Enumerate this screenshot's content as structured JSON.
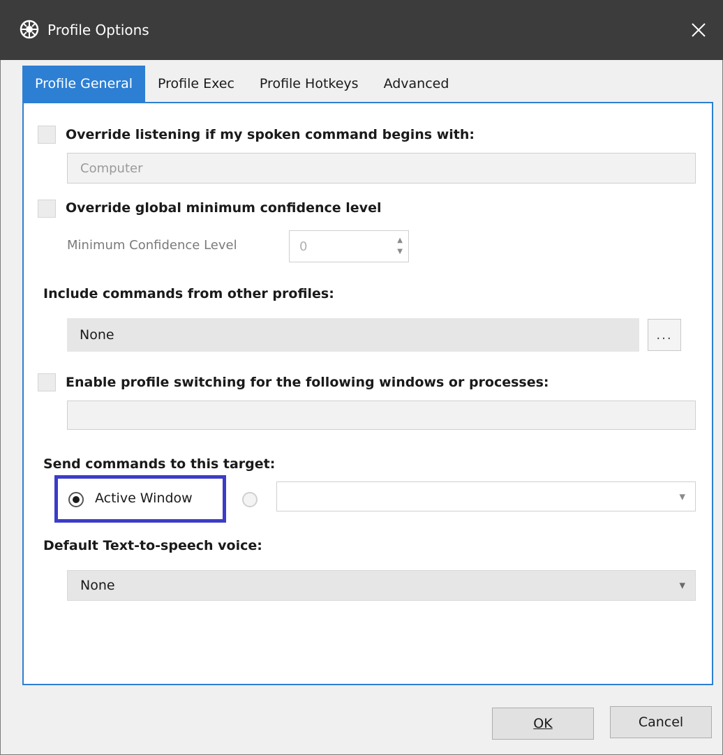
{
  "window": {
    "title": "Profile Options",
    "icon": "voice-app-icon",
    "close_glyph": "✕"
  },
  "tabs": [
    {
      "label": "Profile General",
      "active": true
    },
    {
      "label": "Profile Exec",
      "active": false
    },
    {
      "label": "Profile Hotkeys",
      "active": false
    },
    {
      "label": "Advanced",
      "active": false
    }
  ],
  "general": {
    "override_listening": {
      "label": "Override listening if my spoken command begins with:",
      "checked": false,
      "placeholder": "Computer"
    },
    "override_confidence": {
      "label": "Override global minimum confidence level",
      "checked": false,
      "sub_label": "Minimum Confidence Level",
      "value": "0"
    },
    "include_commands": {
      "label": "Include commands from other profiles:",
      "value": "None",
      "browse_label": "..."
    },
    "profile_switching": {
      "label": "Enable profile switching for the following windows or processes:",
      "checked": false,
      "value": ""
    },
    "send_target": {
      "label": "Send commands to this target:",
      "active_window_label": "Active Window",
      "active_window_selected": true,
      "other_target_value": ""
    },
    "tts_voice": {
      "label": "Default Text-to-speech voice:",
      "value": "None"
    }
  },
  "footer": {
    "ok_label": "OK",
    "cancel_label": "Cancel"
  },
  "colors": {
    "accent": "#2d7fd3",
    "highlight": "#3c3cc8",
    "titlebar": "#3c3c3c"
  }
}
